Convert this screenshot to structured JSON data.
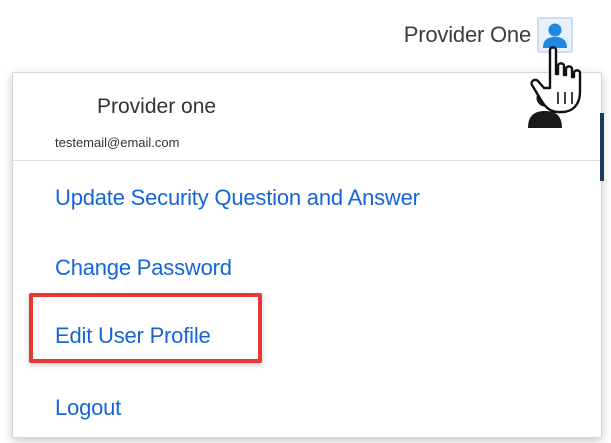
{
  "header": {
    "user_name": "Provider One"
  },
  "icons": {
    "header_avatar": "user-icon",
    "pointer": "hand-pointer-icon",
    "menu_avatar": "user-icon"
  },
  "menu": {
    "profile": {
      "name": "Provider one",
      "email": "testemail@email.com"
    },
    "items": [
      {
        "label": "Update Security Question and Answer"
      },
      {
        "label": "Change Password"
      },
      {
        "label": "Edit User Profile",
        "highlighted": true
      },
      {
        "label": "Logout"
      }
    ]
  },
  "colors": {
    "link": "#1565d8",
    "highlight_border": "#e53935",
    "avatar_accent": "#1e88e5"
  }
}
